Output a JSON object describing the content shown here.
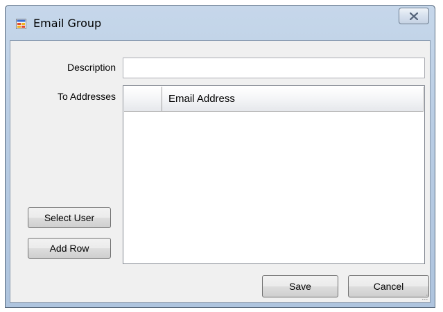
{
  "window": {
    "title": "Email Group",
    "close_icon": "close-icon",
    "app_icon": "form-icon"
  },
  "form": {
    "description_label": "Description",
    "description_value": "",
    "to_addresses_label": "To Addresses"
  },
  "grid": {
    "columns": [
      "Email Address"
    ],
    "rows": []
  },
  "buttons": {
    "select_user": "Select User",
    "add_row": "Add Row",
    "save": "Save",
    "cancel": "Cancel"
  },
  "colors": {
    "title_bar": "#b9cde4",
    "client_bg": "#f0f0f0"
  }
}
